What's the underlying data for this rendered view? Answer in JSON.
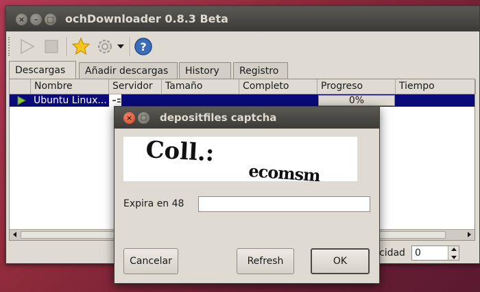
{
  "window": {
    "title": "ochDownloader 0.8.3 Beta",
    "close_glyph": "×",
    "min_glyph": "–",
    "max_glyph": "□"
  },
  "toolbar": {
    "icons": [
      "play-icon",
      "stop-icon",
      "favorite-star-icon",
      "settings-gear-icon",
      "dropdown-arrow-icon",
      "help-icon"
    ],
    "help_glyph": "?"
  },
  "tabs": [
    "Descargas",
    "Añadir descargas",
    "History",
    "Registro"
  ],
  "table": {
    "columns": [
      "Nombre",
      "Servidor",
      "Tamaño",
      "Completo",
      "Progreso",
      "Tiempo"
    ],
    "rows": [
      {
        "name": "Ubuntu Linux...",
        "progress": "0%",
        "progress_value": 0
      }
    ]
  },
  "status": {
    "speed_label": "cidad",
    "speed_value": "0"
  },
  "dialog": {
    "title": "depositfiles captcha",
    "captcha_text": "Coll.: ecomsm",
    "expira_label": "Expira en 48",
    "input_value": "",
    "buttons": {
      "cancel": "Cancelar",
      "refresh": "Refresh",
      "ok": "OK"
    }
  },
  "colors": {
    "titlebar": "#3c3b37",
    "window_bg": "#dfdbd2",
    "selected_row": "#0a0a78",
    "close_button": "#d8491f"
  }
}
